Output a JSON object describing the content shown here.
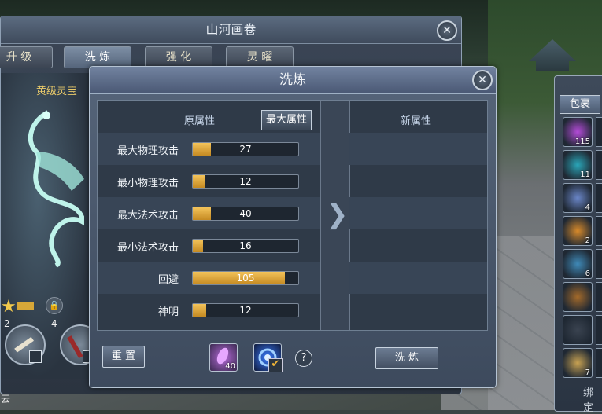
{
  "background_window": {
    "title": "山河画卷",
    "close_label": "✕",
    "tabs": [
      "升 级",
      "洗 炼",
      "强 化",
      "灵 曜"
    ],
    "active_tab": 1,
    "weapon_name": "黄级灵宝",
    "star_count": "2",
    "lock_count": "4",
    "bottom_text": "云"
  },
  "dialog": {
    "title": "洗炼",
    "close_label": "✕",
    "original_header": "原属性",
    "max_attr_button": "最大属性",
    "new_header": "新属性",
    "arrow": "❯",
    "reset_button": "重 置",
    "refine_button": "洗 炼",
    "help_label": "?",
    "item_qty": "40",
    "stats": [
      {
        "label": "最大物理攻击",
        "value": "27",
        "fill": 0.17
      },
      {
        "label": "最小物理攻击",
        "value": "12",
        "fill": 0.11
      },
      {
        "label": "最大法术攻击",
        "value": "40",
        "fill": 0.17
      },
      {
        "label": "最小法术攻击",
        "value": "16",
        "fill": 0.1
      },
      {
        "label": "回避",
        "value": "105",
        "fill": 0.87
      },
      {
        "label": "神明",
        "value": "12",
        "fill": 0.13
      }
    ]
  },
  "inventory": {
    "tab": "包裹",
    "items": [
      {
        "qty": "115",
        "color": "#b44bd8"
      },
      {
        "qty": "11",
        "color": "#2aa6b8"
      },
      {
        "qty": "4",
        "color": "#6a86c8"
      },
      {
        "qty": "2",
        "color": "#d88a2a"
      },
      {
        "qty": "6",
        "color": "#3f8ab8"
      },
      {
        "qty": "",
        "color": "#a46a2a"
      },
      {
        "qty": "",
        "color": "#3a4350"
      },
      {
        "qty": "7",
        "color": "#c8a252"
      }
    ],
    "bottom_label": "绑定"
  }
}
